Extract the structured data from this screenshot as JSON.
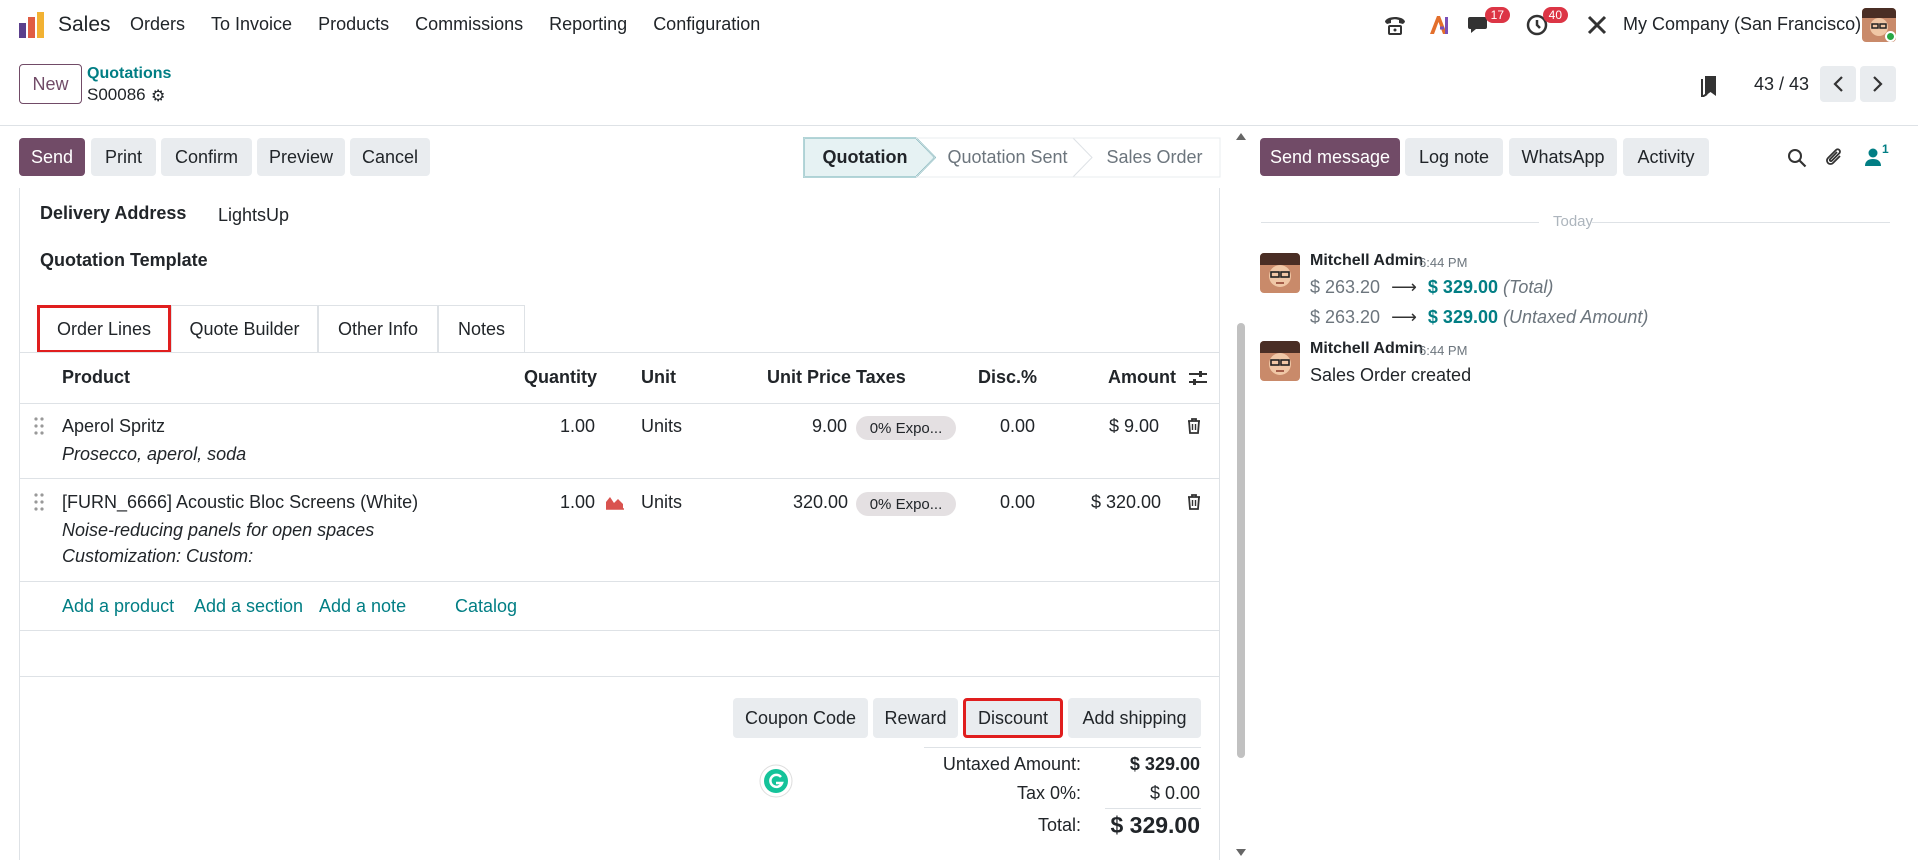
{
  "navbar": {
    "app_name": "Sales",
    "menu": [
      "Orders",
      "To Invoice",
      "Products",
      "Commissions",
      "Reporting",
      "Configuration"
    ],
    "messages_badge": "17",
    "activities_badge": "40",
    "company": "My Company (San Francisco)"
  },
  "control_panel": {
    "new_label": "New",
    "breadcrumb_parent": "Quotations",
    "record_name": "S00086",
    "pager": "43 / 43"
  },
  "actions": {
    "send": "Send",
    "print": "Print",
    "confirm": "Confirm",
    "preview": "Preview",
    "cancel": "Cancel"
  },
  "statusbar": [
    "Quotation",
    "Quotation Sent",
    "Sales Order"
  ],
  "fields": {
    "delivery_address_label": "Delivery Address",
    "delivery_address_value": "LightsUp",
    "quotation_template_label": "Quotation Template"
  },
  "tabs": [
    "Order Lines",
    "Quote Builder",
    "Other Info",
    "Notes"
  ],
  "table": {
    "headers": [
      "Product",
      "Quantity",
      "Unit",
      "Unit Price",
      "Taxes",
      "Disc.%",
      "Amount"
    ],
    "rows": [
      {
        "product": "Aperol Spritz",
        "description": [
          "Prosecco, aperol, soda"
        ],
        "quantity": "1.00",
        "unit": "Units",
        "unit_price": "9.00",
        "taxes": "0% Expo...",
        "discount": "0.00",
        "amount": "$ 9.00"
      },
      {
        "product": "[FURN_6666] Acoustic Bloc Screens (White)",
        "description": [
          "Noise-reducing panels for open spaces",
          "Customization: Custom:"
        ],
        "quantity": "1.00",
        "unit": "Units",
        "unit_price": "320.00",
        "taxes": "0% Expo...",
        "discount": "0.00",
        "amount": "$ 320.00"
      }
    ],
    "add_links": [
      "Add a product",
      "Add a section",
      "Add a note",
      "Catalog"
    ]
  },
  "bottom_buttons": [
    "Coupon Code",
    "Reward",
    "Discount",
    "Add shipping"
  ],
  "totals": {
    "untaxed_label": "Untaxed Amount:",
    "untaxed_value": "$ 329.00",
    "tax_label": "Tax 0%:",
    "tax_value": "$ 0.00",
    "total_label": "Total:",
    "total_value": "$ 329.00"
  },
  "chatter": {
    "send_message": "Send message",
    "log_note": "Log note",
    "whatsapp": "WhatsApp",
    "activity": "Activity",
    "followers_count": "1",
    "today": "Today",
    "messages": [
      {
        "author": "Mitchell Admin",
        "time": "6:44 PM",
        "tracking": [
          {
            "old": "$ 263.20",
            "new": "$ 329.00",
            "field": "(Total)"
          },
          {
            "old": "$ 263.20",
            "new": "$ 329.00",
            "field": "(Untaxed Amount)"
          }
        ]
      },
      {
        "author": "Mitchell Admin",
        "time": "6:44 PM",
        "body": "Sales Order created"
      }
    ]
  },
  "colors": {
    "primary": "#714b67",
    "link": "#017e84",
    "highlight": "#e01e1e"
  }
}
